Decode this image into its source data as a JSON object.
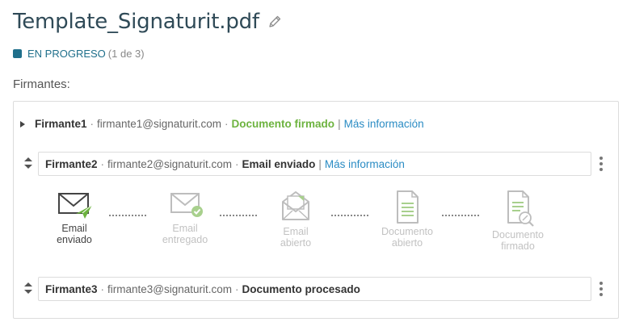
{
  "document": {
    "title": "Template_Signaturit.pdf"
  },
  "status": {
    "label": "EN PROGRESO",
    "count": "(1 de 3)",
    "color": "#1f6f8b"
  },
  "signers_label": "Firmantes:",
  "signers": [
    {
      "name": "Firmante1",
      "separator": "·",
      "email": "firmante1@signaturit.com",
      "status": "Documento firmado",
      "status_color": "#6db33f",
      "link": "Más información"
    },
    {
      "name": "Firmante2",
      "separator": "·",
      "email": "firmante2@signaturit.com",
      "status": "Email enviado",
      "link": "Más información"
    },
    {
      "name": "Firmante3",
      "separator": "·",
      "email": "firmante3@signaturit.com",
      "status": "Documento procesado"
    }
  ],
  "pipe": "|",
  "timeline": [
    {
      "line1": "Email",
      "line2": "enviado",
      "state": "active",
      "icon": "email-sent-icon"
    },
    {
      "line1": "Email",
      "line2": "entregado",
      "state": "inactive",
      "icon": "email-delivered-icon"
    },
    {
      "line1": "Email",
      "line2": "abierto",
      "state": "inactive",
      "icon": "email-opened-icon"
    },
    {
      "line1": "Documento",
      "line2": "abierto",
      "state": "inactive",
      "icon": "document-opened-icon"
    },
    {
      "line1": "Documento",
      "line2": "firmado",
      "state": "inactive",
      "icon": "document-signed-icon"
    }
  ]
}
